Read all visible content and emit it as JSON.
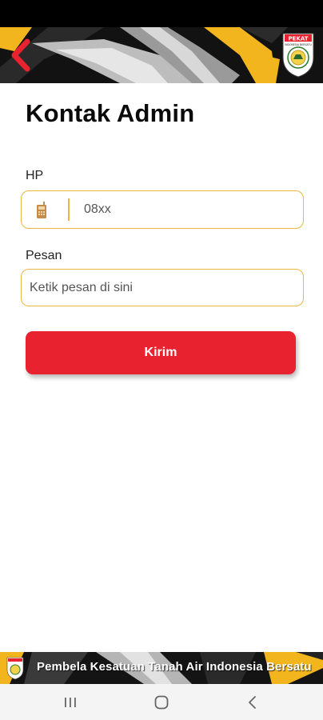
{
  "header": {
    "title": "Kontak Admin"
  },
  "form": {
    "hp_label": "HP",
    "hp_placeholder": "08xx",
    "pesan_label": "Pesan",
    "pesan_placeholder": "Ketik pesan di sini",
    "submit_label": "Kirim"
  },
  "footer": {
    "slogan": "Pembela Kesatuan Tanah Air Indonesia Bersatu"
  },
  "logo_text": {
    "top": "PEKAT",
    "banner": "INDONESIA BERSATU"
  },
  "icons": {
    "back": "arrow-left-icon",
    "phone": "phone-icon",
    "recent": "recent-apps-icon",
    "home": "home-icon",
    "nav_back": "chevron-left-icon"
  },
  "colors": {
    "accent": "#e9b743",
    "button": "#e8222f",
    "header_dark": "#111111",
    "header_gold": "#f2b51e"
  }
}
